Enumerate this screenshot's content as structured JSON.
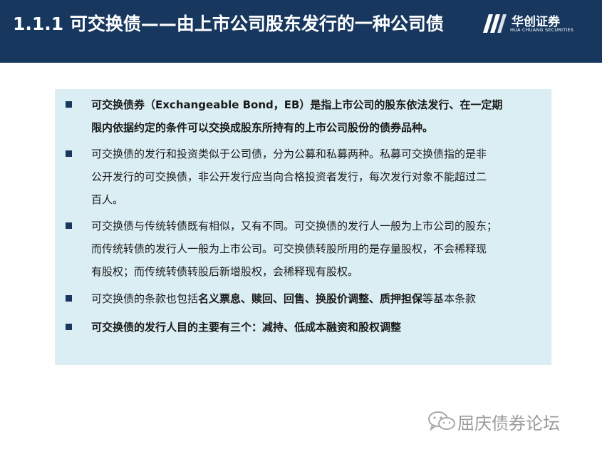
{
  "header": {
    "title": "1.1.1 可交换债——由上市公司股东发行的一种公司债",
    "logo_name": "华创证券",
    "logo_subtitle": "HUA CHUANG SECURITIES"
  },
  "bullets": [
    {
      "line1": "可交换债券（Exchangeable Bond，EB）是指上市公司的股东依法发行、在一定期",
      "line2": "限内依据约定的条件可以交换成股东所持有的上市公司股份的债券品种。"
    },
    {
      "line1": "可交换债的发行和投资类似于公司债，分为公募和私募两种。私募可交换债指的是非",
      "line2": "公开发行的可交换债，非公开发行应当向合格投资者发行，每次发行对象不能超过二",
      "line3": "百人。"
    },
    {
      "line1": "可交换债与传统转债既有相似，又有不同。可交换债的发行人一般为上市公司的股东；",
      "line2": "而传统转债的发行人一般为上市公司。可交换债转股所用的是存量股权，不会稀释现",
      "line3": "有股权；而传统转债转股后新增股权，会稀释现有股权。"
    },
    {
      "prefix": "可交换债的条款也包括",
      "emphasis": "名义票息、赎回、回售、换股价调整、质押担保",
      "suffix": "等基本条款"
    },
    {
      "line1": "可交换债的发行人目的主要有三个：减持、低成本融资和股权调整"
    }
  ],
  "watermark": {
    "text": "屈庆债券论坛",
    "icon": "wechat-icon"
  },
  "colors": {
    "header_bg": "#17375e",
    "box_bg": "#dbeef4",
    "bullet": "#17375e",
    "watermark": "#9a9a9a"
  }
}
